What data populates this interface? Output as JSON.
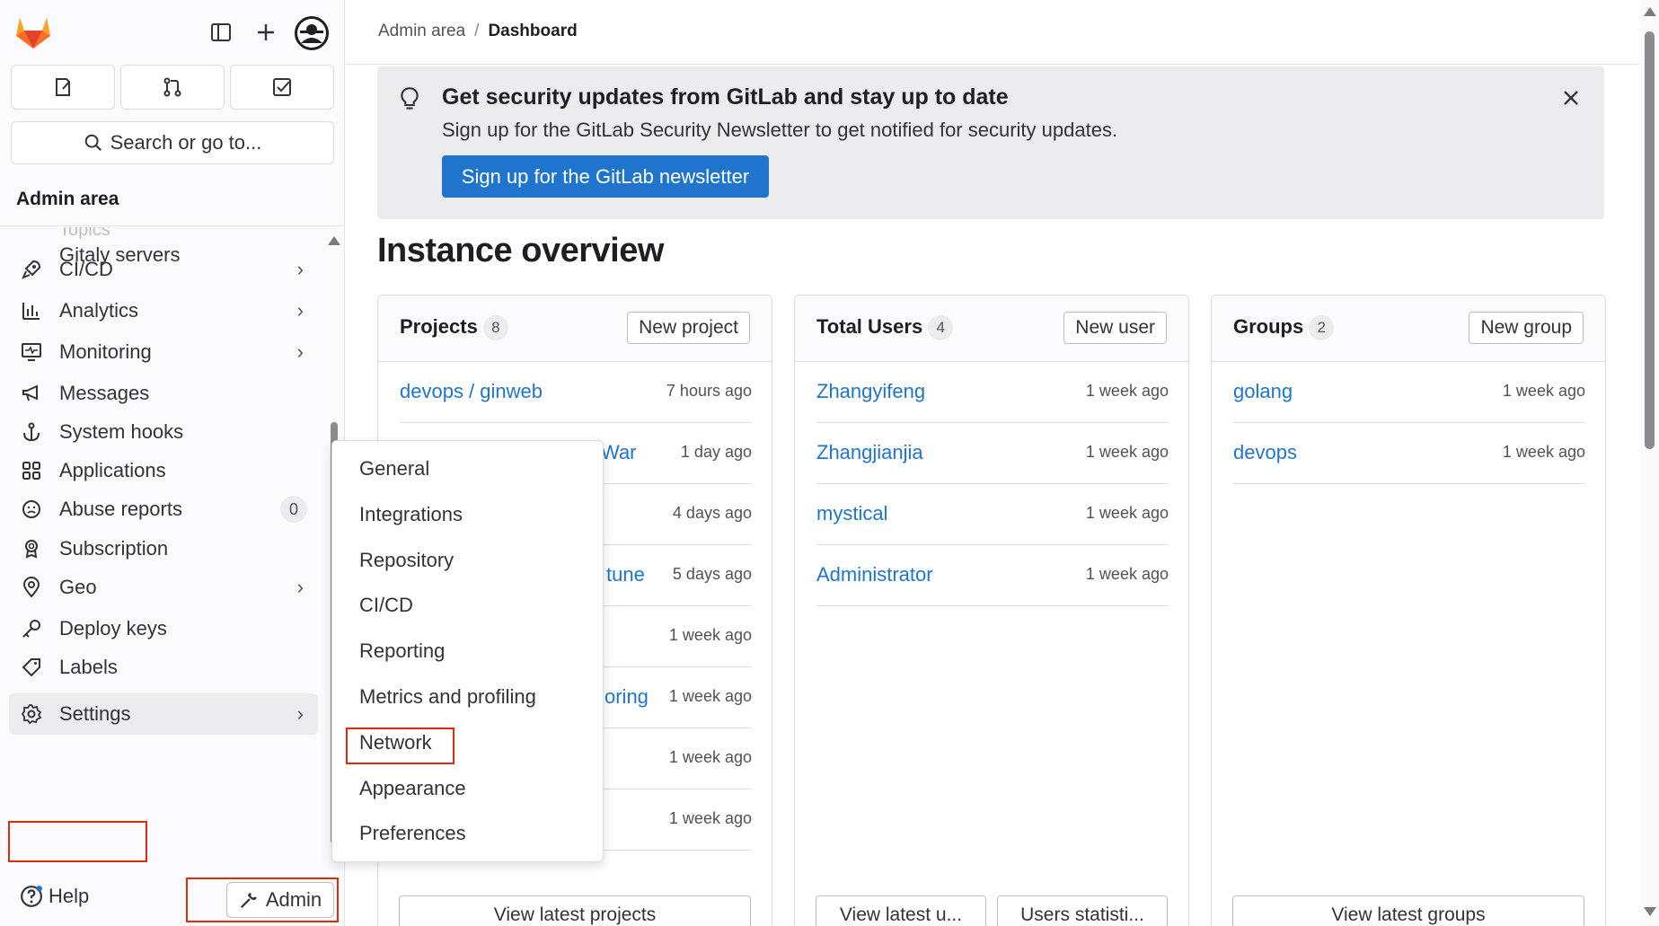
{
  "sidebar": {
    "search_label": "Search or go to...",
    "context_title": "Admin area",
    "ghost_item": "Topics",
    "items": [
      {
        "label": "Gitaly servers",
        "icon": "none"
      },
      {
        "label": "CI/CD",
        "icon": "rocket-icon",
        "chevron": true
      },
      {
        "label": "Analytics",
        "icon": "chart-icon",
        "chevron": true
      },
      {
        "label": "Monitoring",
        "icon": "monitor-icon",
        "chevron": true
      },
      {
        "label": "Messages",
        "icon": "bullhorn-icon"
      },
      {
        "label": "System hooks",
        "icon": "anchor-icon"
      },
      {
        "label": "Applications",
        "icon": "apps-icon"
      },
      {
        "label": "Abuse reports",
        "icon": "abuse-icon",
        "count": "0"
      },
      {
        "label": "Subscription",
        "icon": "license-icon"
      },
      {
        "label": "Geo",
        "icon": "location-icon",
        "chevron": true
      },
      {
        "label": "Deploy keys",
        "icon": "key-icon"
      },
      {
        "label": "Labels",
        "icon": "label-icon"
      },
      {
        "label": "Settings",
        "icon": "settings-icon",
        "chevron": true
      }
    ],
    "help_label": "Help",
    "admin_label": "Admin"
  },
  "breadcrumb": {
    "parent": "Admin area",
    "current": "Dashboard"
  },
  "banner": {
    "title": "Get security updates from GitLab and stay up to date",
    "body": "Sign up for the GitLab Security Newsletter to get notified for security updates.",
    "cta": "Sign up for the GitLab newsletter"
  },
  "page_title": "Instance overview",
  "cards": {
    "projects": {
      "title": "Projects",
      "count": "8",
      "button": "New project",
      "rows": [
        {
          "name": "devops / ginweb",
          "time": "7 hours ago"
        },
        {
          "name": "War",
          "time": "1 day ago"
        },
        {
          "name": "",
          "time": "4 days ago"
        },
        {
          "name": "tune",
          "time": "5 days ago"
        },
        {
          "name": "",
          "time": "1 week ago"
        },
        {
          "name": "oring",
          "time": "1 week ago"
        },
        {
          "name": "",
          "time": "1 week ago"
        },
        {
          "name": "",
          "time": "1 week ago"
        }
      ],
      "footer": "View latest projects"
    },
    "users": {
      "title": "Total Users",
      "count": "4",
      "button": "New user",
      "rows": [
        {
          "name": "Zhangyifeng",
          "time": "1 week ago"
        },
        {
          "name": "Zhangjianjia",
          "time": "1 week ago"
        },
        {
          "name": "mystical",
          "time": "1 week ago"
        },
        {
          "name": "Administrator",
          "time": "1 week ago"
        }
      ],
      "footer1": "View latest u...",
      "footer2": "Users statisti..."
    },
    "groups": {
      "title": "Groups",
      "count": "2",
      "button": "New group",
      "rows": [
        {
          "name": "golang",
          "time": "1 week ago"
        },
        {
          "name": "devops",
          "time": "1 week ago"
        }
      ],
      "footer": "View latest groups"
    }
  },
  "settings_menu": [
    "General",
    "Integrations",
    "Repository",
    "CI/CD",
    "Reporting",
    "Metrics and profiling",
    "Network",
    "Appearance",
    "Preferences"
  ],
  "colors": {
    "accent": "#1f75cb",
    "highlight": "#dd2b0e",
    "banner_bg": "#ececef"
  }
}
